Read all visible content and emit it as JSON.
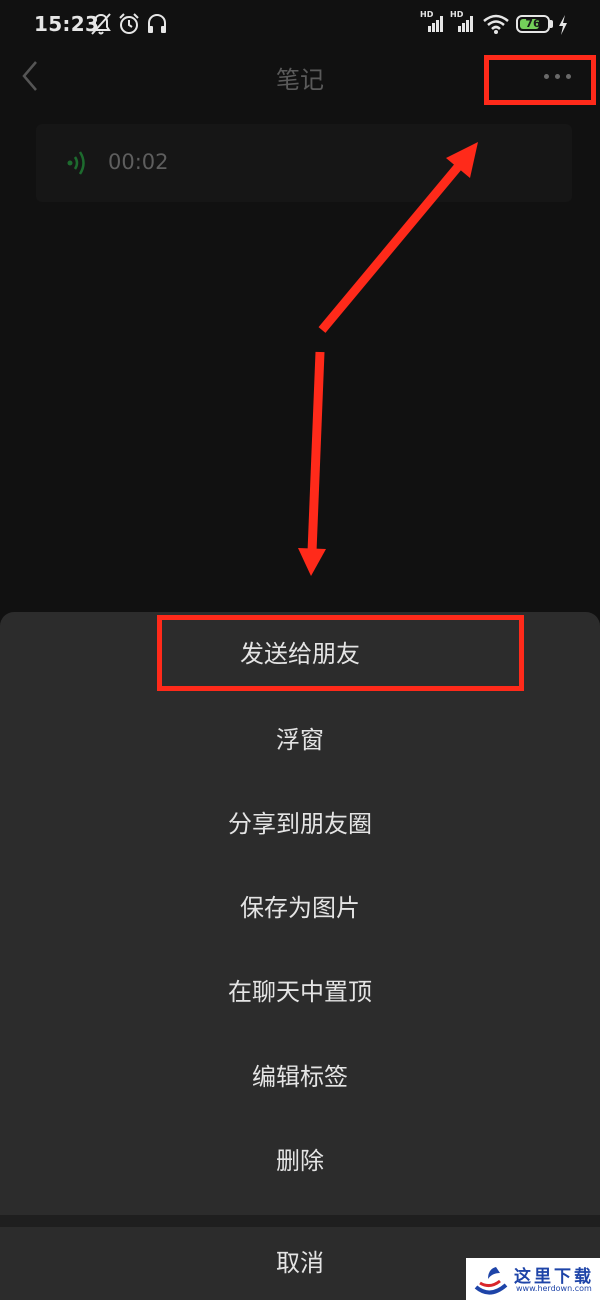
{
  "status_bar": {
    "time": "15:23",
    "signal1_label": "HD",
    "signal2_label": "HD",
    "battery_level": "76",
    "battery_color": "#74d05a"
  },
  "nav": {
    "title": "笔记",
    "back_icon": "chevron-left-icon",
    "more_icon": "more-horizontal-icon"
  },
  "voice_note": {
    "icon": "voice-wave-icon",
    "icon_color": "#1d6b2e",
    "duration": "00:02"
  },
  "menu": {
    "items": [
      {
        "label": "发送给朋友"
      },
      {
        "label": "浮窗"
      },
      {
        "label": "分享到朋友圈"
      },
      {
        "label": "保存为图片"
      },
      {
        "label": "在聊天中置顶"
      },
      {
        "label": "编辑标签"
      },
      {
        "label": "删除"
      }
    ],
    "cancel_label": "取消"
  },
  "annotation": {
    "highlight_color": "#ff2a1a"
  },
  "watermark": {
    "text": "这里下载",
    "url": "www.herdown.com"
  }
}
